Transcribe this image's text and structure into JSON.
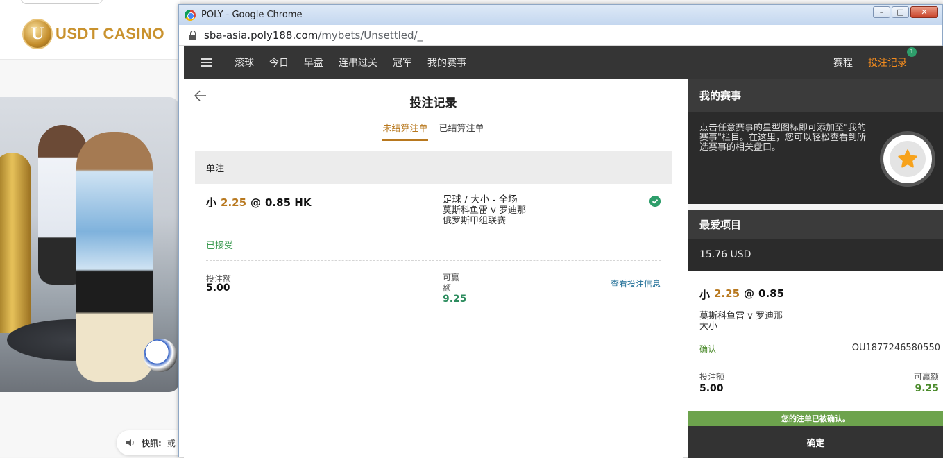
{
  "background_site": {
    "logo_text": "USDT CASINO",
    "logo_badge": "U",
    "ticker_label": "快訊:",
    "ticker_text": "或"
  },
  "window": {
    "title": "POLY - Google Chrome",
    "url_host": "sba-asia.poly188.com",
    "url_path": "/mybets/Unsettled/_",
    "controls": {
      "minimize": "–",
      "maximize": "□",
      "close": "✕"
    }
  },
  "nav": {
    "items": [
      "滚球",
      "今日",
      "早盘",
      "连串过关",
      "冠军",
      "我的赛事"
    ],
    "schedule": "赛程",
    "bet_record": "投注记录",
    "bet_record_badge": "1"
  },
  "main": {
    "title": "投注记录",
    "tabs": {
      "unsettled": "未结算注单",
      "settled": "已结算注单"
    },
    "section": "单注",
    "bet": {
      "selection": "小",
      "handicap": "2.25",
      "at": "@",
      "odds": "0.85 HK",
      "market": "足球 / 大小 - 全场",
      "match": "莫斯科鱼雷 v 罗迪那",
      "league": "俄罗斯甲组联赛",
      "status": "已接受",
      "stake_label": "投注额",
      "stake": "5.00",
      "win_label": "可赢额",
      "win": "9.25",
      "view_info": "查看投注信息"
    }
  },
  "right": {
    "my_events_title": "我的赛事",
    "my_events_desc": "点击任意赛事的星型图标即可添加至\"我的赛事\"栏目。在这里，您可以轻松查看到所选赛事的相关盘口。",
    "favorites_title": "最爱项目",
    "balance": "15.76 USD",
    "slip": {
      "selection": "小",
      "handicap": "2.25",
      "at": "@",
      "odds": "0.85",
      "match": "莫斯科鱼雷 v 罗迪那",
      "market": "大小",
      "confirm": "确认",
      "ref": "OU1877246580550",
      "stake_label": "投注额",
      "stake": "5.00",
      "win_label": "可赢额",
      "win": "9.25"
    },
    "confirmed_banner": "您的注单已被确认。",
    "ok_button": "确定"
  },
  "colors": {
    "accent_orange": "#f28b1e",
    "handicap_gold": "#b8781e",
    "success_green": "#2e9e6b",
    "banner_green": "#6da34d",
    "nav_dark": "#353535"
  }
}
